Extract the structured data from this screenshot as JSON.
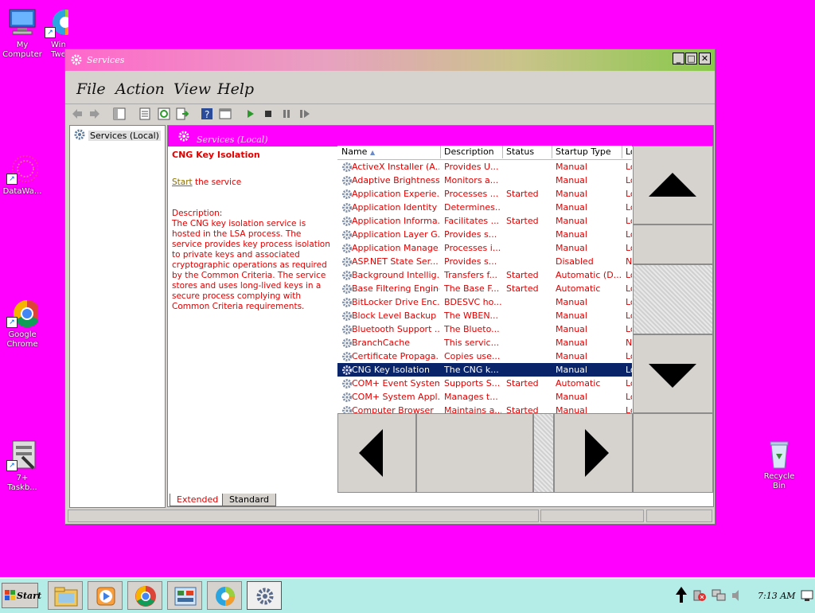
{
  "desktop": {
    "icons": [
      {
        "label": "My\nComputer",
        "name": "my-computer"
      },
      {
        "label": "Win\nTwe",
        "name": "win-tweaker"
      },
      {
        "label": "DataWa...",
        "name": "datawa"
      },
      {
        "label": "Google\nChrome",
        "name": "google-chrome"
      },
      {
        "label": "7+\nTaskb...",
        "name": "taskbar-tweaker"
      },
      {
        "label": "Recycle\nBin",
        "name": "recycle-bin"
      }
    ]
  },
  "window": {
    "title": "Services",
    "min_label": "_",
    "max_label": "□",
    "close_label": "✕"
  },
  "menu": {
    "file": "File",
    "action": "Action",
    "view": "View",
    "help": "Help"
  },
  "tree": {
    "root": "Services (Local)"
  },
  "panel_header": "Services (Local)",
  "details": {
    "service_name": "CNG Key Isolation",
    "start_link": "Start",
    "start_rest": " the service",
    "description_label": "Description:",
    "description": "The CNG key isolation service is hosted in the LSA process. The service provides key process isolation to private keys and associated cryptographic operations as required by the Common Criteria. The service stores and uses long-lived keys in a secure process complying with Common Criteria requirements."
  },
  "columns": {
    "name": "Name",
    "description": "Description",
    "status": "Status",
    "startup": "Startup Type",
    "logon": "Lo"
  },
  "rows": [
    {
      "name": "ActiveX Installer (A...",
      "desc": "Provides U...",
      "status": "",
      "startup": "Manual",
      "logon": "Lo"
    },
    {
      "name": "Adaptive Brightness",
      "desc": "Monitors a...",
      "status": "",
      "startup": "Manual",
      "logon": "Lo"
    },
    {
      "name": "Application Experie...",
      "desc": "Processes ...",
      "status": "Started",
      "startup": "Manual",
      "logon": "Lo"
    },
    {
      "name": "Application Identity",
      "desc": "Determines...",
      "status": "",
      "startup": "Manual",
      "logon": "Lo"
    },
    {
      "name": "Application Informa...",
      "desc": "Facilitates ...",
      "status": "Started",
      "startup": "Manual",
      "logon": "Lo"
    },
    {
      "name": "Application Layer G...",
      "desc": "Provides s...",
      "status": "",
      "startup": "Manual",
      "logon": "Lo"
    },
    {
      "name": "Application Manage...",
      "desc": "Processes i...",
      "status": "",
      "startup": "Manual",
      "logon": "Lo"
    },
    {
      "name": "ASP.NET State Ser...",
      "desc": "Provides s...",
      "status": "",
      "startup": "Disabled",
      "logon": "N"
    },
    {
      "name": "Background Intellig...",
      "desc": "Transfers f...",
      "status": "Started",
      "startup": "Automatic (D...",
      "logon": "Lo"
    },
    {
      "name": "Base Filtering Engine",
      "desc": "The Base F...",
      "status": "Started",
      "startup": "Automatic",
      "logon": "Lo"
    },
    {
      "name": "BitLocker Drive Enc...",
      "desc": "BDESVC ho...",
      "status": "",
      "startup": "Manual",
      "logon": "Lo"
    },
    {
      "name": "Block Level Backup ...",
      "desc": "The WBEN...",
      "status": "",
      "startup": "Manual",
      "logon": "Lo"
    },
    {
      "name": "Bluetooth Support ...",
      "desc": "The Blueto...",
      "status": "",
      "startup": "Manual",
      "logon": "Lo"
    },
    {
      "name": "BranchCache",
      "desc": "This servic...",
      "status": "",
      "startup": "Manual",
      "logon": "N"
    },
    {
      "name": "Certificate Propaga...",
      "desc": "Copies use...",
      "status": "",
      "startup": "Manual",
      "logon": "Lo"
    },
    {
      "name": "CNG Key Isolation",
      "desc": "The CNG k...",
      "status": "",
      "startup": "Manual",
      "logon": "Lo",
      "selected": true
    },
    {
      "name": "COM+ Event System",
      "desc": "Supports S...",
      "status": "Started",
      "startup": "Automatic",
      "logon": "Lo"
    },
    {
      "name": "COM+ System Appl...",
      "desc": "Manages t...",
      "status": "",
      "startup": "Manual",
      "logon": "Lo"
    },
    {
      "name": "Computer Browser",
      "desc": "Maintains a...",
      "status": "Started",
      "startup": "Manual",
      "logon": "Lo"
    }
  ],
  "tabs": {
    "extended": "Extended",
    "standard": "Standard"
  },
  "taskbar": {
    "start": "Start",
    "clock": "7:13 AM"
  },
  "colors": {
    "desktop": "#ff00ff",
    "service_text": "#e00000",
    "selection": "#0a246a",
    "taskbar": "#b4ece8"
  }
}
